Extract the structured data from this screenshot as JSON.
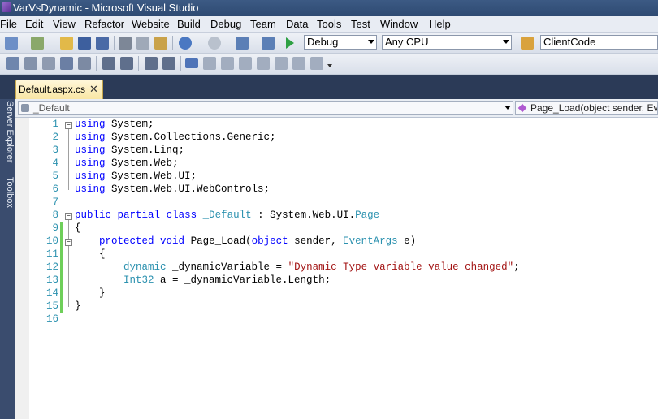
{
  "window": {
    "title": "VarVsDynamic - Microsoft Visual Studio"
  },
  "menu": [
    "File",
    "Edit",
    "View",
    "Refactor",
    "Website",
    "Build",
    "Debug",
    "Team",
    "Data",
    "Tools",
    "Test",
    "Window",
    "Help"
  ],
  "toolbar": {
    "config": "Debug",
    "platform": "Any CPU",
    "find_value": "ClientCode"
  },
  "tabs": [
    {
      "label": "Default.aspx.cs",
      "close": "✕"
    }
  ],
  "side_tools": [
    "Server Explorer",
    "Toolbox"
  ],
  "nav": {
    "type_selector": "_Default",
    "member_selector": "Page_Load(object sender, EventArgs e)"
  },
  "code": {
    "lines": [
      [
        {
          "t": "using",
          "c": "kw"
        },
        {
          "t": " System;"
        }
      ],
      [
        {
          "t": "using",
          "c": "kw"
        },
        {
          "t": " System.Collections.Generic;"
        }
      ],
      [
        {
          "t": "using",
          "c": "kw"
        },
        {
          "t": " System.Linq;"
        }
      ],
      [
        {
          "t": "using",
          "c": "kw"
        },
        {
          "t": " System.Web;"
        }
      ],
      [
        {
          "t": "using",
          "c": "kw"
        },
        {
          "t": " System.Web.UI;"
        }
      ],
      [
        {
          "t": "using",
          "c": "kw"
        },
        {
          "t": " System.Web.UI.WebControls;"
        }
      ],
      [],
      [
        {
          "t": "public",
          "c": "kw"
        },
        {
          "t": " "
        },
        {
          "t": "partial",
          "c": "kw"
        },
        {
          "t": " "
        },
        {
          "t": "class",
          "c": "kw"
        },
        {
          "t": " "
        },
        {
          "t": "_Default",
          "c": "ty"
        },
        {
          "t": " : System.Web.UI."
        },
        {
          "t": "Page",
          "c": "ty"
        }
      ],
      [
        {
          "t": "{"
        }
      ],
      [
        {
          "t": "    "
        },
        {
          "t": "protected",
          "c": "kw"
        },
        {
          "t": " "
        },
        {
          "t": "void",
          "c": "kw"
        },
        {
          "t": " Page_Load("
        },
        {
          "t": "object",
          "c": "kw"
        },
        {
          "t": " sender, "
        },
        {
          "t": "EventArgs",
          "c": "ty"
        },
        {
          "t": " e)"
        }
      ],
      [
        {
          "t": "    {"
        }
      ],
      [
        {
          "t": "        "
        },
        {
          "t": "dynamic",
          "c": "ty"
        },
        {
          "t": " _dynamicVariable = "
        },
        {
          "t": "\"Dynamic Type variable value changed\"",
          "c": "str"
        },
        {
          "t": ";"
        }
      ],
      [
        {
          "t": "        "
        },
        {
          "t": "Int32",
          "c": "ty"
        },
        {
          "t": " a = _dynamicVariable.Length;"
        }
      ],
      [
        {
          "t": "    }"
        }
      ],
      [
        {
          "t": "}"
        }
      ],
      []
    ],
    "line_numbers": [
      "1",
      "2",
      "3",
      "4",
      "5",
      "6",
      "7",
      "8",
      "9",
      "10",
      "11",
      "12",
      "13",
      "14",
      "15",
      "16"
    ],
    "changed_lines": [
      9,
      10,
      11,
      12,
      13,
      14,
      15
    ]
  }
}
